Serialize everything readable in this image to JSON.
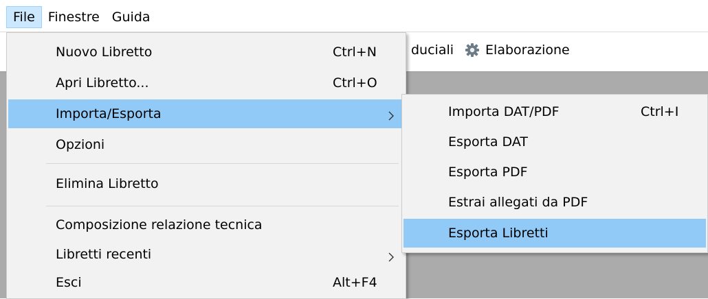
{
  "menubar": {
    "items": [
      "File",
      "Finestre",
      "Guida"
    ]
  },
  "toolbar": {
    "partial_label": "duciali",
    "elaborazione_label": "Elaborazione"
  },
  "file_menu": {
    "items": [
      {
        "label": "Nuovo Libretto",
        "shortcut": "Ctrl+N"
      },
      {
        "label": "Apri Libretto...",
        "shortcut": "Ctrl+O"
      },
      {
        "label": "Importa/Esporta",
        "shortcut": ""
      },
      {
        "label": "Opzioni",
        "shortcut": ""
      },
      {
        "label": "Elimina Libretto",
        "shortcut": ""
      },
      {
        "label": "Composizione relazione tecnica",
        "shortcut": ""
      },
      {
        "label": "Libretti recenti",
        "shortcut": ""
      },
      {
        "label": "Esci",
        "shortcut": "Alt+F4"
      }
    ]
  },
  "submenu": {
    "items": [
      {
        "label": "Importa DAT/PDF",
        "shortcut": "Ctrl+I"
      },
      {
        "label": "Esporta DAT",
        "shortcut": ""
      },
      {
        "label": "Esporta PDF",
        "shortcut": ""
      },
      {
        "label": "Estrai allegati da PDF",
        "shortcut": ""
      },
      {
        "label": "Esporta Libretti",
        "shortcut": ""
      }
    ]
  },
  "colors": {
    "highlight": "#91c9f7",
    "menubar_active": "#cce8ff",
    "menu_bg": "#f2f2f2",
    "workspace": "#ababab"
  }
}
